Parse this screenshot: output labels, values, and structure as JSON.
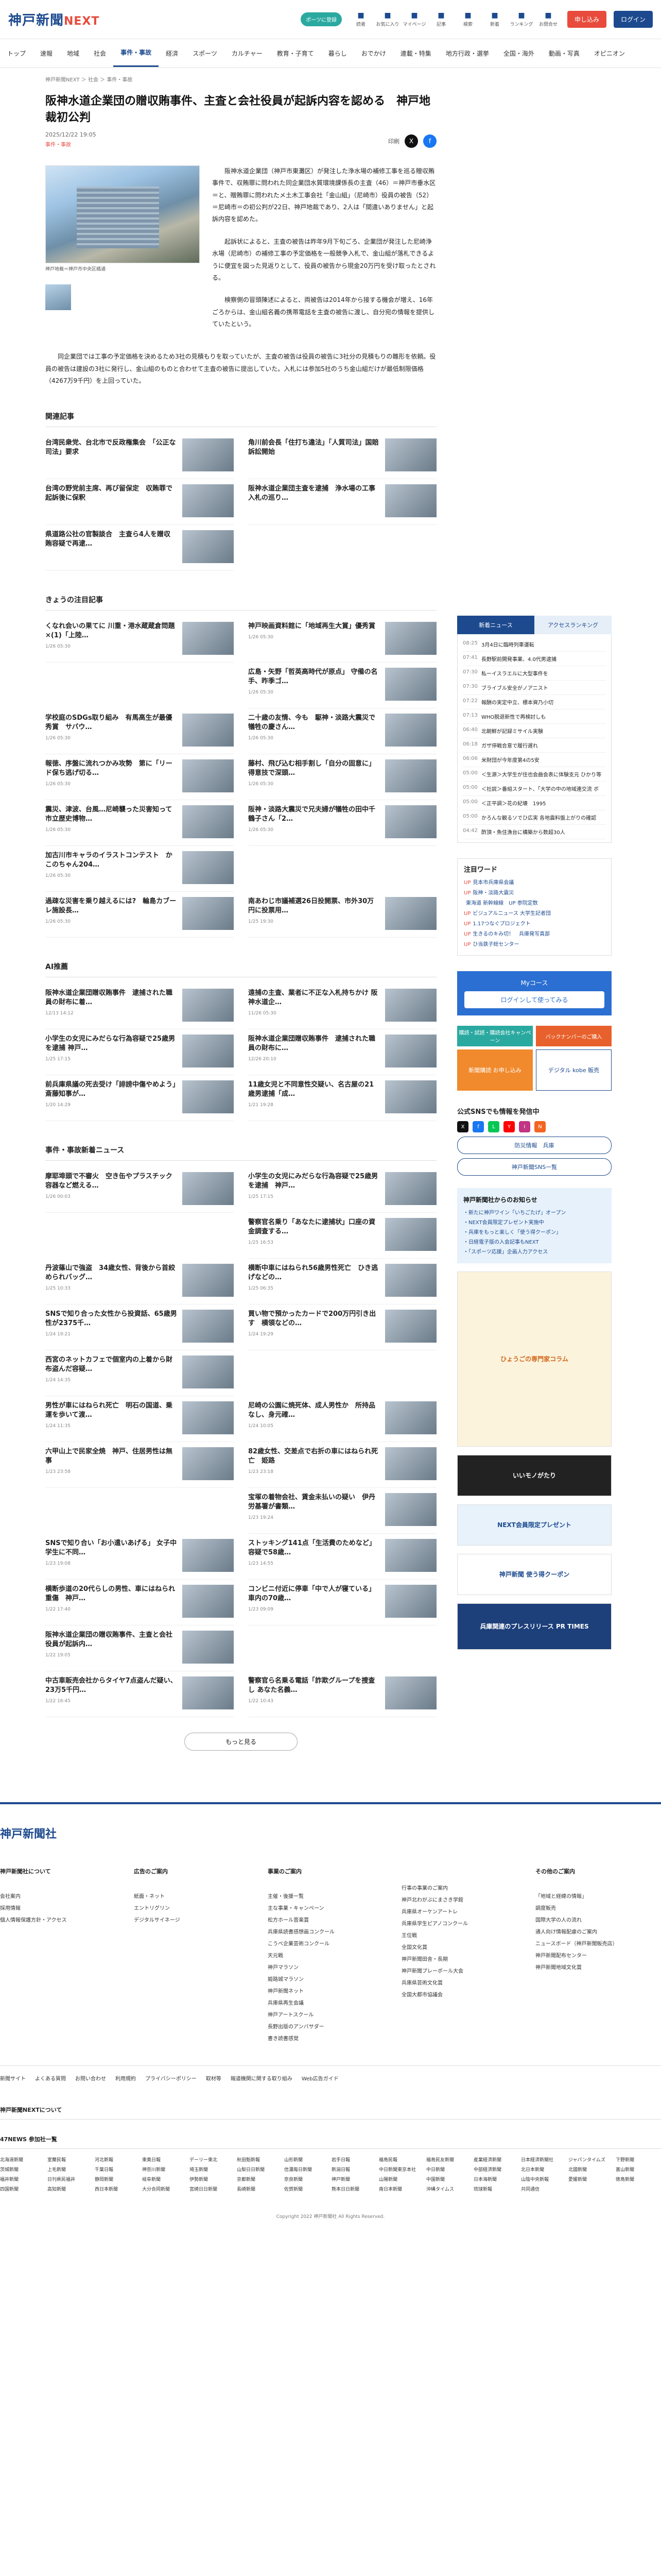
{
  "header": {
    "logo_main": "神戸新聞",
    "logo_sub": "NEXT",
    "pill": "ポーツに登録",
    "tools": [
      {
        "icon": "note-icon",
        "label": "読者"
      },
      {
        "icon": "bookmark-icon",
        "label": "お気に入り"
      },
      {
        "icon": "user-icon",
        "label": "マイページ"
      },
      {
        "icon": "menu-icon",
        "label": "記事"
      },
      {
        "icon": "search-icon",
        "label": "検索"
      },
      {
        "icon": "news-icon",
        "label": "新着"
      },
      {
        "icon": "ranking-icon",
        "label": "ランキング"
      },
      {
        "icon": "help-icon",
        "label": "お問合せ"
      }
    ],
    "signup": "申し込み",
    "login": "ログイン"
  },
  "nav": [
    "トップ",
    "速報",
    "地域",
    "社会",
    "事件・事故",
    "経済",
    "スポーツ",
    "カルチャー",
    "教育・子育て",
    "暮らし",
    "おでかけ",
    "連載・特集",
    "地方行政・選挙",
    "全国・海外",
    "動画・写真",
    "オピニオン"
  ],
  "crumb": "神戸新聞NEXT ＞ 社会 ＞ 事件・事故",
  "article": {
    "title": "阪神水道企業団の贈収賄事件、主査と会社役員が起訴内容を認める　神戸地裁初公判",
    "date": "2025/12/22 19:05",
    "tag": "事件・事故",
    "share_label": "印刷",
    "photo_caption": "神戸地裁＝神戸市中央区橘通",
    "paras": [
      "　阪神水道企業団（神戸市東灘区）が発注した浄水場の補修工事を巡る贈収賄事件で、収賄罪に問われた同企業団水質環境課係長の主査（46）＝神戸市垂水区＝と、贈賄罪に問われたメ土木工事会社「金山組」（尼崎市）役員の被告（52）＝尼崎市＝の初公判が22日、神戸地裁であり、2人は「間違いありません」と起訴内容を認めた。",
      "　起訴状によると、主査の被告は昨年9月下旬ごろ、企業団が発注した尼崎浄水場（尼崎市）の補修工事の予定価格を一般競争入札で、金山組が落札できるように便宜を図った見返りとして、役員の被告から現金20万円を受け取ったとされる。",
      "　検察側の冒頭陳述によると、両被告は2014年から接する機会が増え、16年ごろからは、金山組名義の携帯電話を主査の被告に渡し、自分宛の情報を提供していたという。"
    ],
    "para_last": "　同企業団では工事の予定価格を決めるため3社の見積もりを取っていたが、主査の被告は役員の被告に3社分の見積もりの雛形を依頼。役員の被告は建設の3社に発行し、金山組のものと合わせて主査の被告に提出していた。入札には参加5社のうち金山組だけが最低制限価格（4267万9千円）を上回っていた。"
  },
  "related": {
    "heading": "関連記事",
    "items": [
      {
        "t": "台湾民衆党、台北市で反政権集会　「公正な司法」要求",
        "d": ""
      },
      {
        "t": "角川前会長「住打ち違法」「人質司法」国賠訴訟開始",
        "d": ""
      },
      {
        "t": "台湾の野党前主席、再び留保定　収賄罪で起訴後に保釈",
        "d": ""
      },
      {
        "t": "阪神水道企業団主査を逮捕　浄水場の工事入札の巡り…",
        "d": ""
      },
      {
        "t": "県道路公社の官製談合　主査ら4人を贈収賄容疑で再逮…",
        "d": ""
      }
    ]
  },
  "today": {
    "heading": "きょうの注目記事",
    "items": [
      {
        "t": "くなれ会いの果てに 川重・港水蔵蔵倉問題×(1)「上陸…",
        "d": "1/26 05:30"
      },
      {
        "t": "神戸映画資料館に「地域再生大賞」優秀賞",
        "d": "1/26 05:30"
      },
      {
        "t": "",
        "d": ""
      },
      {
        "t": "広島・矢野「哲英高時代が原点」 守備の名手、昨季ゴ…",
        "d": "1/26 05:30"
      },
      {
        "t": "学校庭のSDGs取り組み　有馬高生が最優秀賞　サバウ…",
        "d": "1/26 05:30"
      },
      {
        "t": "二十歳の友情、今も　駆神・淡路大震災で犠牲の慶さん…",
        "d": "1/26 05:30"
      },
      {
        "t": "報徳、序盤に流れつかみ攻勢　第に「リード保ち逃げ切る…",
        "d": "1/26 05:30"
      },
      {
        "t": "藤村、飛び込む相手割し「自分の固意に」 得意技で深頭…",
        "d": "1/26 05:30"
      },
      {
        "t": "震災、津波、台風…尼崎襲った災害知って　市立歴史博物…",
        "d": "1/26 05:30"
      },
      {
        "t": "阪神・淡路大震災で兄夫婦が犠牲の田中千鶴子さん「2…",
        "d": "1/26 05:30"
      },
      {
        "t": "加古川市キャラのイラストコンテスト　かこのちゃん204…",
        "d": "1/26 05:30"
      },
      {
        "t": "",
        "d": ""
      },
      {
        "t": "過疎な災害を乗り越えるには?　輪島カブーレ施設長…",
        "d": "1/26 05:30"
      },
      {
        "t": "南あわじ市議補選26日投開票、市外30万円に投票用…",
        "d": "1/25 19:30"
      }
    ]
  },
  "ai": {
    "heading": "AI推薦",
    "items": [
      {
        "t": "阪神水道企業団贈収賄事件　逮捕された職員の財布に着…",
        "d": "12/13 14:12"
      },
      {
        "t": "遠捕の主査、業者に不正な入札持ちかけ 阪神水道企…",
        "d": "11/26 05:30"
      },
      {
        "t": "小学生の女児にみだらな行為容疑で25歳男を逮捕 神戸…",
        "d": "1/25 17:15"
      },
      {
        "t": "阪神水道企業団贈収賄事件　逮捕された職員の財布に…",
        "d": "12/26 20:10"
      },
      {
        "t": "前兵庫県議の死去受け「誹謗中傷やめよう」斎藤知事が…",
        "d": "1/20 14:29"
      },
      {
        "t": "11歳女児と不同意性交疑い、名古屋の21歳男逮捕「成…",
        "d": "1/21 19:28"
      }
    ]
  },
  "jiken": {
    "heading": "事件・事故新着ニュース",
    "items": [
      {
        "t": "摩耶埠頭で不審火　空き缶やプラスチック容器など燃える…",
        "d": "1/26 00:03"
      },
      {
        "t": "小学生の女児にみだらな行為容疑で25歳男を逮捕　神戸…",
        "d": "1/25 17:15"
      },
      {
        "t": "",
        "d": ""
      },
      {
        "t": "警察官名乗り「あなたに逮捕状」口座の資金調査する…",
        "d": "1/25 16:53"
      },
      {
        "t": "丹波篠山で強盗　34歳女性、背後から首絞められバッグ…",
        "d": "1/25 10:33"
      },
      {
        "t": "横断中車にはねられ56歳男性死亡　ひき逃げなどの…",
        "d": "1/25 06:35"
      },
      {
        "t": "SNSで知り合った女性から投資話、65歳男性が2375千…",
        "d": "1/24 19:21"
      },
      {
        "t": "買い物で預かったカードで200万円引き出す　横領などの…",
        "d": "1/24 19:29"
      },
      {
        "t": "西宮のネットカフェで個室内の上着から財布盗んだ容疑…",
        "d": "1/24 14:35"
      },
      {
        "t": "",
        "d": ""
      },
      {
        "t": "男性が車にはねられ死亡　明石の国道、乗運を歩いて渡…",
        "d": "1/24 11:35"
      },
      {
        "t": "尼崎の公園に焼死体、成人男性か　所持品なし、身元確…",
        "d": "1/24 10:05"
      },
      {
        "t": "六甲山上で民家全焼　神戸、住居男性は無事",
        "d": "1/23 23:58"
      },
      {
        "t": "82歳女性、交差点で右折の車にはねられ死亡　姫路",
        "d": "1/23 23:18"
      },
      {
        "t": "",
        "d": ""
      },
      {
        "t": "宝塚の着物会社、賃金未払いの疑い　伊丹労基署が書類…",
        "d": "1/23 19:24"
      },
      {
        "t": "SNSで知り合い「お小遣いあげる」 女子中学生に不同…",
        "d": "1/23 19:08"
      },
      {
        "t": "ストッキング141点「生活費のためなど」容疑で58歳…",
        "d": "1/23 14:55"
      },
      {
        "t": "横断歩道の20代らしの男性、車にはねられ重傷　神戸…",
        "d": "1/22 17:40"
      },
      {
        "t": "コンビニ付近に停車「中で人が寝ている」車内の70歳…",
        "d": "1/23 09:09"
      },
      {
        "t": "阪神水道企業団の贈収賄事件、主査と会社役員が起訴内…",
        "d": "1/22 19:05"
      },
      {
        "t": "",
        "d": ""
      },
      {
        "t": "中古車販売会社からタイヤ7点盗んだ疑い、23万5千円…",
        "d": "1/22 16:45"
      },
      {
        "t": "警察官ら名乗る電話「詐欺グループを捜査し あなた名義…",
        "d": "1/22 10:43"
      }
    ],
    "more": "もっと見る"
  },
  "side": {
    "tabs": [
      "新着ニュース",
      "アクセスランキング"
    ],
    "news": [
      {
        "time": "08:25",
        "t": "3月4日に臨時列車運転"
      },
      {
        "time": "07:41",
        "t": "長野駅前開発事業、4.0代男逮捕"
      },
      {
        "time": "07:30",
        "t": "私ーイスラエルに大型事件を"
      },
      {
        "time": "07:30",
        "t": "ブライブル安全がノアニスト"
      },
      {
        "time": "07:22",
        "t": "報酬の実定中立、標本資乃小切"
      },
      {
        "time": "07:13",
        "t": "WHO脱退新性で再検討しも"
      },
      {
        "time": "06:40",
        "t": "北朝鮮が記録ミサイル実験"
      },
      {
        "time": "06:18",
        "t": "ガザ停戦合意で履行遅れ"
      },
      {
        "time": "06:06",
        "t": "米財団が今年度第4の5安"
      },
      {
        "time": "05:00",
        "t": "＜生源＞大学生が住也会曲会表に体験支元 ひかり等"
      },
      {
        "time": "05:00",
        "t": "＜社説＞番組スタート、「大学の中の地域連交流 ボ"
      },
      {
        "time": "05:00",
        "t": "＜正平調＞花の紀壊　1995"
      },
      {
        "time": "05:00",
        "t": "かろんな観るソでひ広実 各地震料盤上がりの確認"
      },
      {
        "time": "04:42",
        "t": "酢頂・魚住漁台に構築から数超30人"
      }
    ],
    "keywords_heading": "注目ワード",
    "keywords": [
      {
        "up": "UP",
        "k": "見本市兵庫県会議"
      },
      {
        "up": "UP",
        "k": "阪神・淡路大震災"
      },
      {
        "up": "",
        "k": "東海道 新幹線線　UP 参院定数"
      },
      {
        "up": "UP",
        "k": "ビジュアルニュース 大学生記者団"
      },
      {
        "up": "UP",
        "k": "1.17つなぐプロジェクト"
      },
      {
        "up": "UP",
        "k": "生きるのキみ切！　兵庫発写真部"
      },
      {
        "up": "UP",
        "k": "ひ当鉄子総センター"
      }
    ],
    "mycourse": "Myコース",
    "mycourse_btn": "ログインして使ってみる",
    "banner1": "購読・試読・購読会社キャンペーン",
    "banner2": "バックナンバーのご購入",
    "banner3": "新聞購読 お申し込み",
    "banner4": "デジタル kobe 販売",
    "sns_heading": "公式SNSでも情報を発信中",
    "sns": [
      "X",
      "f",
      "L",
      "Y",
      "I",
      "N"
    ],
    "line_btn": "防災情報　兵庫",
    "sns_btn": "神戸新聞SNS一覧",
    "info_heading": "神戸新聞社からのお知らせ",
    "info": [
      "・新たに神戸ワイン「いちごたげ」オープン",
      "・NEXT会員限定プレゼント実施中",
      "・兵庫をもっと楽しく「使う得クーポン」",
      "・日経電子版の入会記事もNEXT",
      "・「スポーツ応援」企画人力アクセス"
    ],
    "ad1": "ひょうごの専門家コラム",
    "ad2": "いいモノがたり",
    "ad3": "NEXT会員限定プレゼント",
    "ad4": "神戸新聞 使う得クーポン",
    "ad5": "兵庫関連のプレスリリース PR TIMES"
  },
  "footer": {
    "logo": "神戸新聞社",
    "cols": [
      {
        "h": "神戸新聞社について",
        "items": [
          "会社案内",
          "採用情報",
          "個人情報保護方針・アクセス"
        ]
      },
      {
        "h": "広告のご案内",
        "items": [
          "紙面・ネット",
          "エントリグリン",
          "デジタルサイネージ"
        ]
      },
      {
        "h": "事業のご案内",
        "items": [
          "主催・後援一覧",
          "主な事業・キャンペーン",
          "松方ホール音楽賞",
          "兵庫県読書感想画コンクール",
          "こうべ企業芸術コンクール",
          "天元戦",
          "神戸マラソン",
          "姫路城マラソン",
          "神戸新聞ネット",
          "兵庫県再生会議",
          "神戸アートスクール",
          "長野出版のアンバサダー",
          "書き読書感覚"
        ]
      },
      {
        "h": "",
        "items": [
          "行事の事業のご案内",
          "神戸北わがぶにまさき学館",
          "兵庫県オーケンアートレ",
          "兵庫県学生ピアノコンクール",
          "王位戦",
          "全国文化賞",
          "神戸新聞田舎・長期",
          "神戸新聞プレーボール大会",
          "兵庫県芸術文化賞",
          "全国大都市協議会"
        ]
      },
      {
        "h": "その他のご案内",
        "items": [
          "「地域と経緯の情報」",
          "調度販売",
          "国際大学の人の流れ",
          "通人向け情報配慮のご案内",
          "ニュースボード（神戸新聞販売店）",
          "神戸新聞配布センター",
          "神戸新聞地域文化賞"
        ]
      }
    ],
    "bar": [
      "新聞サイト",
      "よくある質問",
      "お問い合わせ",
      "利用規約",
      "プライバシーポリシー",
      "取材等",
      "報道機関に関する取り組み",
      "Web広告ガイド"
    ],
    "next_title": "神戸新聞NEXTについて",
    "members_title": "47NEWS 参加社一覧",
    "members": [
      "北海道新聞",
      "室蘭民報",
      "河北新報",
      "東奥日報",
      "デーリー東北",
      "秋田魁新報",
      "山形新聞",
      "岩手日報",
      "福島民報",
      "福島民友新聞",
      "産業経済新聞",
      "日本経済新聞社",
      "ジャパンタイムズ",
      "下野新聞",
      "茨城新聞",
      "上毛新聞",
      "千葉日報",
      "神奈川新聞",
      "埼玉新聞",
      "山梨日日新聞",
      "信濃毎日新聞",
      "新潟日報",
      "中日新聞東京本社",
      "中日新聞",
      "中部経済新聞",
      "北日本新聞",
      "北國新聞",
      "富山新聞",
      "福井新聞",
      "日刊県民福井",
      "静岡新聞",
      "岐阜新聞",
      "伊勢新聞",
      "京都新聞",
      "奈良新聞",
      "神戸新聞",
      "山陽新聞",
      "中国新聞",
      "日本海新聞",
      "山陰中央新報",
      "愛媛新聞",
      "徳島新聞",
      "四国新聞",
      "高知新聞",
      "西日本新聞",
      "大分合同新聞",
      "宮崎日日新聞",
      "長崎新聞",
      "佐賀新聞",
      "熊本日日新聞",
      "南日本新聞",
      "沖縄タイムス",
      "琉球新報",
      "共同通信"
    ],
    "copyright": "Copyright 2022 神戸新聞社 All Rights Reserved."
  }
}
